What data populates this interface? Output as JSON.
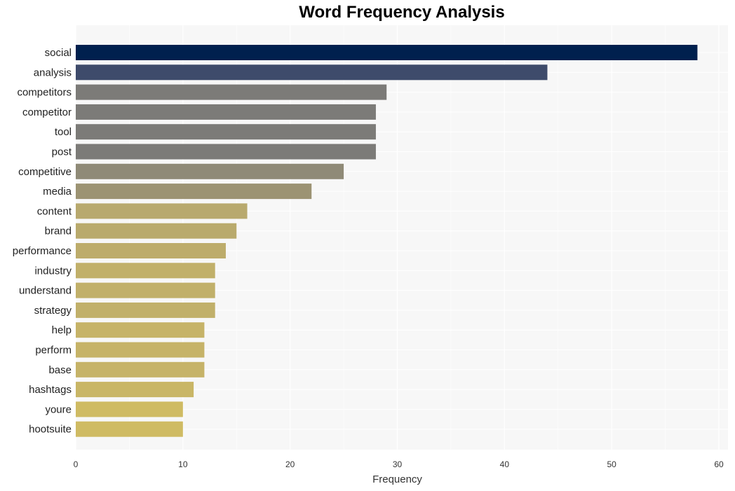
{
  "chart_data": {
    "type": "bar",
    "orientation": "horizontal",
    "title": "Word Frequency Analysis",
    "xlabel": "Frequency",
    "ylabel": "",
    "xlim": [
      0,
      60
    ],
    "xticks": [
      0,
      10,
      20,
      30,
      40,
      50,
      60
    ],
    "grid": true,
    "categories": [
      "social",
      "analysis",
      "competitors",
      "competitor",
      "tool",
      "post",
      "competitive",
      "media",
      "content",
      "brand",
      "performance",
      "industry",
      "understand",
      "strategy",
      "help",
      "perform",
      "base",
      "hashtags",
      "youre",
      "hootsuite"
    ],
    "values": [
      58,
      44,
      29,
      28,
      28,
      28,
      25,
      22,
      16,
      15,
      14,
      13,
      13,
      13,
      12,
      12,
      12,
      11,
      10,
      10
    ],
    "colors": [
      "#00204e",
      "#3e4b6b",
      "#7c7b78",
      "#7c7b78",
      "#7c7b78",
      "#7c7b78",
      "#8f8a77",
      "#9c9373",
      "#b8a96e",
      "#b9aa6d",
      "#bdac6b",
      "#c1b06a",
      "#c1b06a",
      "#c1b06a",
      "#c6b368",
      "#c6b368",
      "#c6b368",
      "#c9b666",
      "#cfbb63",
      "#cfbb63"
    ],
    "background": "#f7f7f7"
  }
}
